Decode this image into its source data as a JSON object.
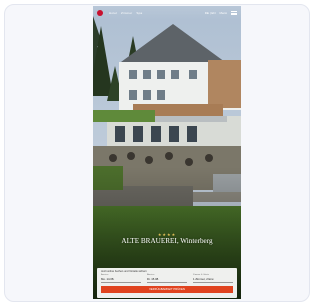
{
  "nav": {
    "links": [
      "Hotel",
      "Zimmer",
      "Spa"
    ],
    "right": [
      "DE | EN",
      "Menü"
    ]
  },
  "hero": {
    "stars": "★★★★",
    "hotel_name": "ALTE BRAUEREI, Winterberg"
  },
  "booking": {
    "title": "Jetzt online buchen und Vorteile sichern",
    "fields": [
      {
        "label": "Anreise",
        "value": "Mo. 14.08."
      },
      {
        "label": "Abreise",
        "value": "Di. 15.08."
      },
      {
        "label": "Zimmer & Gäste",
        "value": "1 Zimmer, 2 Erw."
      }
    ],
    "cta": "VERFÜGBARKEIT PRÜFEN"
  },
  "colors": {
    "brand_red": "#c8102e",
    "cta_orange": "#e0431f",
    "card_bg": "#f6f7fb"
  },
  "icons": {
    "logo": "logo-icon",
    "menu": "menu-icon"
  }
}
